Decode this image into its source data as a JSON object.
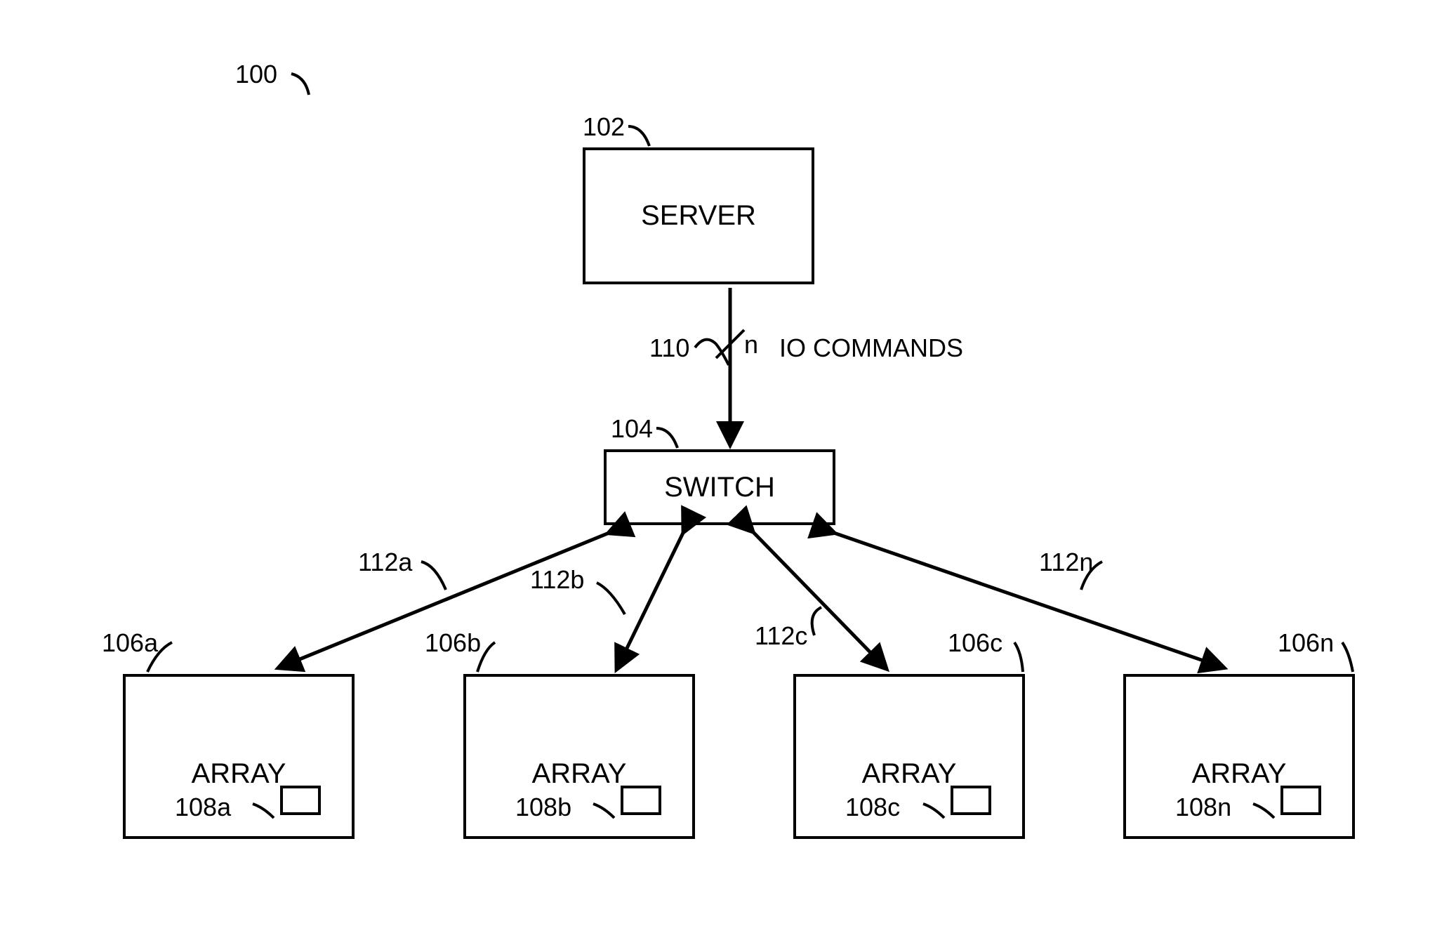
{
  "figure_label": "100",
  "server": {
    "ref": "102",
    "label": "SERVER"
  },
  "switch": {
    "ref": "104",
    "label": "SWITCH"
  },
  "connection_server_switch": {
    "ref": "110",
    "mult": "n",
    "annotation": "IO COMMANDS"
  },
  "switch_connections": {
    "a": "112a",
    "b": "112b",
    "c": "112c",
    "n": "112n"
  },
  "arrays": {
    "a": {
      "ref": "106a",
      "label": "ARRAY",
      "inner_ref": "108a"
    },
    "b": {
      "ref": "106b",
      "label": "ARRAY",
      "inner_ref": "108b"
    },
    "c": {
      "ref": "106c",
      "label": "ARRAY",
      "inner_ref": "108c"
    },
    "n": {
      "ref": "106n",
      "label": "ARRAY",
      "inner_ref": "108n"
    }
  }
}
